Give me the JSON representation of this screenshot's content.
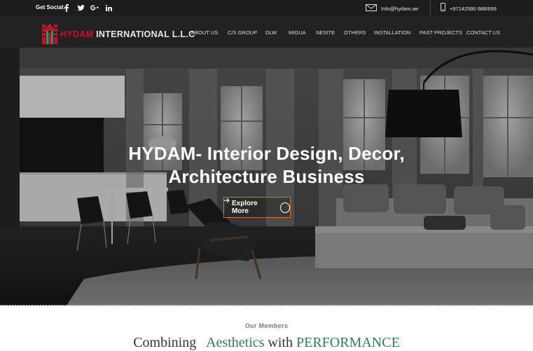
{
  "topbar": {
    "social_label": "Get Social:",
    "social_icons": [
      "facebook-icon",
      "twitter-icon",
      "google-plus-icon",
      "linkedin-icon"
    ],
    "email": "Info@hydam.ae",
    "phone": "+97142580 688/699"
  },
  "logo": {
    "brand": "HYDAM",
    "rest": " INTERNATIONAL L.L.C"
  },
  "nav": {
    "items": [
      "ABOUT US",
      "C/S GROUP",
      "DLW",
      "MIGUA",
      "NESITE",
      "OTHERS",
      "INSTALLATION",
      "PAST PROJECTS",
      "CONTACT US"
    ]
  },
  "hero": {
    "title_line1": "HYDAM- Interior Design, Decor,",
    "title_line2": "Architecture Business",
    "button_label": "Explore More"
  },
  "members": {
    "heading": "Our Members",
    "tagline_a": "Combining",
    "tagline_b": "Aesthetics",
    "tagline_c": "with",
    "tagline_d": "PERFORMANCE"
  },
  "colors": {
    "topbar_bg": "#1c1c1c",
    "nav_bg": "#222222",
    "logo_red": "#c8102e",
    "button_border": "#c97d23",
    "accent_green": "#2f7a62"
  }
}
